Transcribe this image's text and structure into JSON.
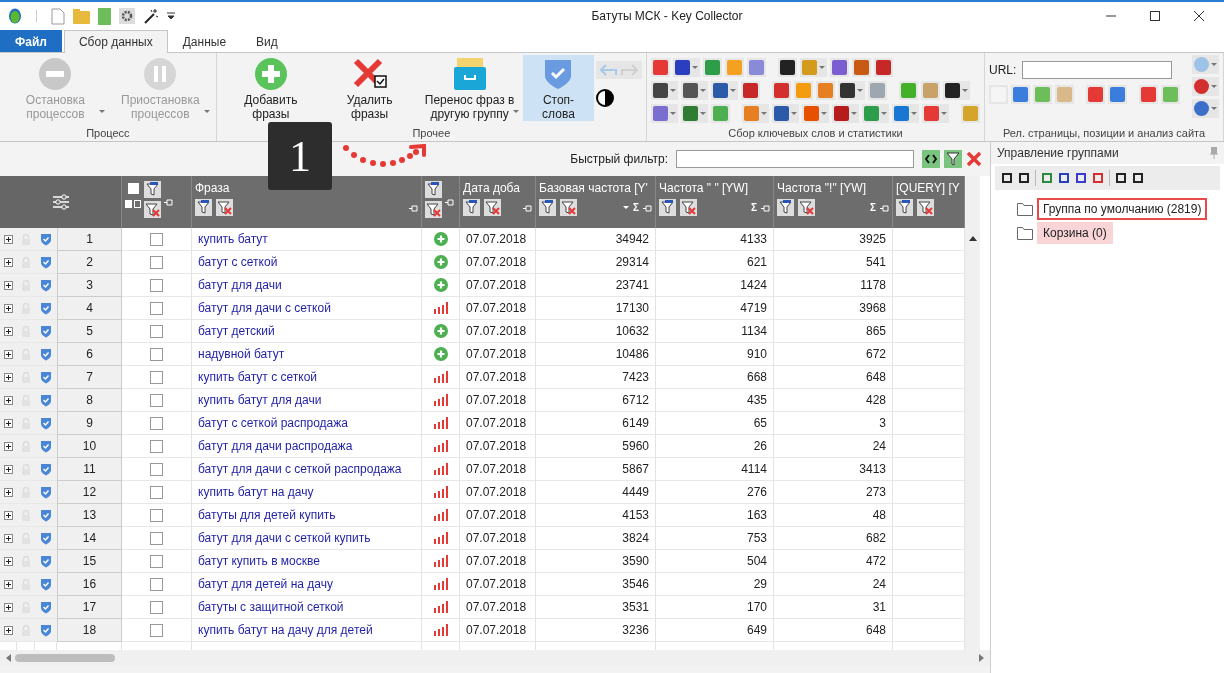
{
  "window": {
    "title": "Батуты МСК - Key Collector"
  },
  "tabs": [
    {
      "label": "Файл",
      "kind": "file",
      "selected": false
    },
    {
      "label": "Сбор данных",
      "kind": "tab",
      "selected": true
    },
    {
      "label": "Данные",
      "kind": "tab",
      "selected": false
    },
    {
      "label": "Вид",
      "kind": "tab",
      "selected": false
    }
  ],
  "ribbon": {
    "groups": [
      {
        "label": "Процесс",
        "buttons": [
          {
            "label": "Остановка процессов",
            "kind": "stop",
            "disabled": true,
            "selected": false,
            "dropdown": true
          },
          {
            "label": "Приостановка процессов",
            "kind": "pause",
            "disabled": true,
            "selected": false,
            "dropdown": true
          }
        ]
      },
      {
        "label": "Прочее",
        "buttons": [
          {
            "label": "Добавить фразы",
            "kind": "add",
            "disabled": false,
            "selected": false,
            "dropdown": false
          },
          {
            "label": "Удалить фразы",
            "kind": "delete",
            "disabled": false,
            "selected": false,
            "dropdown": false
          },
          {
            "label": "Перенос фраз в другую группу",
            "kind": "move",
            "disabled": false,
            "selected": false,
            "dropdown": true
          },
          {
            "label": "Стоп-слова",
            "kind": "shield",
            "disabled": false,
            "selected": true,
            "dropdown": false
          }
        ]
      },
      {
        "label": "Сбор ключевых слов и статистики"
      },
      {
        "label": "Рел. страницы, позиции и анализ сайта",
        "url_label": "URL:"
      }
    ]
  },
  "tutorial": {
    "step": "1"
  },
  "filter": {
    "label": "Быстрый фильтр:"
  },
  "grid": {
    "select_all_checked": false,
    "columns": [
      {
        "label": "Фраза"
      },
      {
        "label": "Дата доба"
      },
      {
        "label": "Базовая частота [Y'",
        "sum": "Σ",
        "sorted": true
      },
      {
        "label": "Частота \" \" [YW]",
        "sum": "Σ"
      },
      {
        "label": "Частота \"!\" [YW]",
        "sum": "Σ"
      },
      {
        "label": "[QUERY] [Y"
      }
    ],
    "rows": [
      {
        "n": "1",
        "phrase": "купить батут",
        "kind": "added",
        "date": "07.07.2018",
        "base": "34942",
        "f1": "4133",
        "f2": "3925",
        "checked": false
      },
      {
        "n": "2",
        "phrase": "батут с сеткой",
        "kind": "added",
        "date": "07.07.2018",
        "base": "29314",
        "f1": "621",
        "f2": "541",
        "checked": false
      },
      {
        "n": "3",
        "phrase": "батут для дачи",
        "kind": "added",
        "date": "07.07.2018",
        "base": "23741",
        "f1": "1424",
        "f2": "1178",
        "checked": false
      },
      {
        "n": "4",
        "phrase": "батут для дачи с сеткой",
        "kind": "stats",
        "date": "07.07.2018",
        "base": "17130",
        "f1": "4719",
        "f2": "3968",
        "checked": false
      },
      {
        "n": "5",
        "phrase": "батут детский",
        "kind": "added",
        "date": "07.07.2018",
        "base": "10632",
        "f1": "1134",
        "f2": "865",
        "checked": false
      },
      {
        "n": "6",
        "phrase": "надувной батут",
        "kind": "added",
        "date": "07.07.2018",
        "base": "10486",
        "f1": "910",
        "f2": "672",
        "checked": false
      },
      {
        "n": "7",
        "phrase": "купить батут с сеткой",
        "kind": "stats",
        "date": "07.07.2018",
        "base": "7423",
        "f1": "668",
        "f2": "648",
        "checked": false
      },
      {
        "n": "8",
        "phrase": "купить батут для дачи",
        "kind": "stats",
        "date": "07.07.2018",
        "base": "6712",
        "f1": "435",
        "f2": "428",
        "checked": false
      },
      {
        "n": "9",
        "phrase": "батут с сеткой распродажа",
        "kind": "stats",
        "date": "07.07.2018",
        "base": "6149",
        "f1": "65",
        "f2": "3",
        "checked": false
      },
      {
        "n": "10",
        "phrase": "батут для дачи распродажа",
        "kind": "stats",
        "date": "07.07.2018",
        "base": "5960",
        "f1": "26",
        "f2": "24",
        "checked": false
      },
      {
        "n": "11",
        "phrase": "батут для дачи с сеткой распродажа",
        "kind": "stats",
        "date": "07.07.2018",
        "base": "5867",
        "f1": "4114",
        "f2": "3413",
        "checked": false
      },
      {
        "n": "12",
        "phrase": "купить батут на дачу",
        "kind": "stats",
        "date": "07.07.2018",
        "base": "4449",
        "f1": "276",
        "f2": "273",
        "checked": false
      },
      {
        "n": "13",
        "phrase": "батуты для детей купить",
        "kind": "stats",
        "date": "07.07.2018",
        "base": "4153",
        "f1": "163",
        "f2": "48",
        "checked": false
      },
      {
        "n": "14",
        "phrase": "батут для дачи с сеткой купить",
        "kind": "stats",
        "date": "07.07.2018",
        "base": "3824",
        "f1": "753",
        "f2": "682",
        "checked": false
      },
      {
        "n": "15",
        "phrase": "батут купить в москве",
        "kind": "stats",
        "date": "07.07.2018",
        "base": "3590",
        "f1": "504",
        "f2": "472",
        "checked": false
      },
      {
        "n": "16",
        "phrase": "батут для детей на дачу",
        "kind": "stats",
        "date": "07.07.2018",
        "base": "3546",
        "f1": "29",
        "f2": "24",
        "checked": false
      },
      {
        "n": "17",
        "phrase": "батуты с защитной сеткой",
        "kind": "stats",
        "date": "07.07.2018",
        "base": "3531",
        "f1": "170",
        "f2": "31",
        "checked": false
      },
      {
        "n": "18",
        "phrase": "купить батут на дачу для детей",
        "kind": "stats",
        "date": "07.07.2018",
        "base": "3236",
        "f1": "649",
        "f2": "648",
        "checked": false
      }
    ]
  },
  "groups_panel": {
    "title": "Управление группами",
    "items": [
      {
        "label": "Группа по умолчанию (2819)",
        "selected": true,
        "highlighted": false
      },
      {
        "label": "Корзина (0)",
        "selected": false,
        "highlighted": true
      }
    ]
  }
}
